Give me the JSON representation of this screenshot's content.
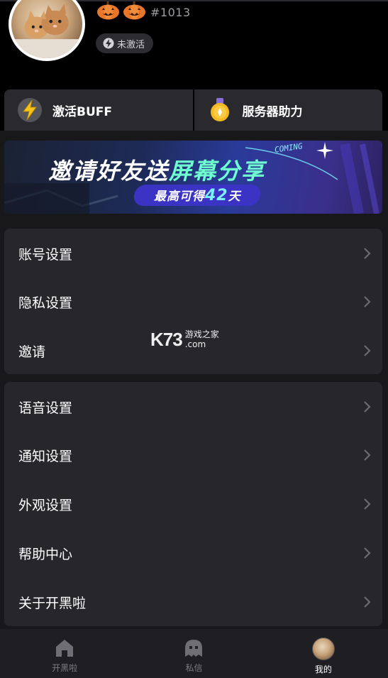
{
  "profile": {
    "user_id": "#1013",
    "status_text": "未激活",
    "badges": [
      "pumpkin-badge",
      "pumpkin-badge"
    ]
  },
  "features": [
    {
      "label": "激活BUFF",
      "icon": "lightning-icon"
    },
    {
      "label": "服务器助力",
      "icon": "medal-icon"
    }
  ],
  "banner": {
    "title_main": "邀请好友送",
    "title_highlight": "屏幕分享",
    "coming_tag": "COMING",
    "subtitle_prefix": "最高可得",
    "subtitle_number": "42",
    "subtitle_suffix": "天"
  },
  "menu_group_1": [
    {
      "label": "账号设置"
    },
    {
      "label": "隐私设置"
    },
    {
      "label": "邀请"
    }
  ],
  "menu_group_2": [
    {
      "label": "语音设置"
    },
    {
      "label": "通知设置"
    },
    {
      "label": "外观设置"
    },
    {
      "label": "帮助中心"
    },
    {
      "label": "关于开黑啦"
    }
  ],
  "watermark": {
    "brand": "K73",
    "cn": "游戏之家",
    "domain": ".com"
  },
  "tabbar": [
    {
      "label": "开黑啦",
      "icon": "home-icon",
      "active": false
    },
    {
      "label": "私信",
      "icon": "chat-ghost-icon",
      "active": false
    },
    {
      "label": "我的",
      "icon": "avatar",
      "active": true
    }
  ],
  "colors": {
    "background": "#000000",
    "panel": "#27272b",
    "content_bg": "#18181b",
    "tabbar": "#1f1f23",
    "banner_highlight": "#6dffd0",
    "lightning": "#f5c518",
    "medal": "#f6b820"
  }
}
